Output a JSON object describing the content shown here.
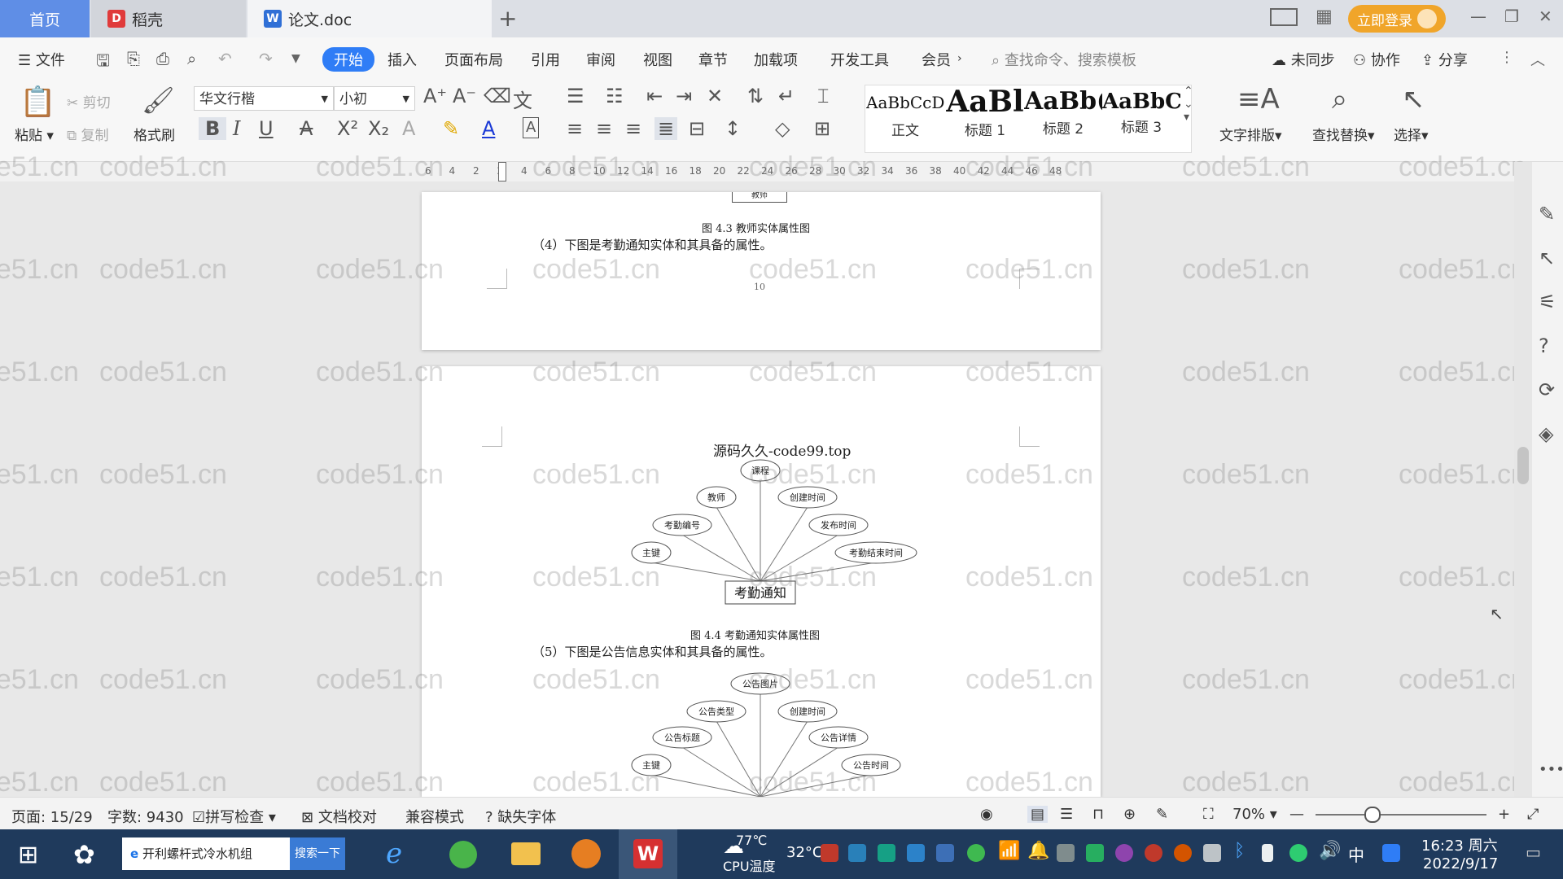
{
  "tabs": [
    {
      "label": "首页"
    },
    {
      "label": "稻壳"
    },
    {
      "label": "论文.doc"
    }
  ],
  "titlebar": {
    "login_label": "立即登录"
  },
  "menu": {
    "file_label": "文件",
    "items": [
      "开始",
      "插入",
      "页面布局",
      "引用",
      "审阅",
      "视图",
      "章节",
      "加载项",
      "开发工具",
      "会员"
    ],
    "search_cmd": "查找命令、搜索模板",
    "sync_label": "未同步",
    "collab_label": "协作",
    "share_label": "分享"
  },
  "toolbar": {
    "paste": "粘贴",
    "cut": "剪切",
    "copy": "复制",
    "format_painter": "格式刷",
    "font_name": "华文行楷",
    "font_size": "小初",
    "styles": [
      {
        "sample": "AaBbCcDd",
        "label": "正文"
      },
      {
        "sample": "AaBl",
        "label": "标题 1"
      },
      {
        "sample": "AaBb(",
        "label": "标题 2"
      },
      {
        "sample": "AaBbC",
        "label": "标题 3"
      }
    ],
    "text_layout": "文字排版",
    "find_replace": "查找替换",
    "select": "选择"
  },
  "ruler": {
    "ticks": [
      "6",
      "4",
      "2",
      "2",
      "4",
      "6",
      "8",
      "10",
      "12",
      "14",
      "16",
      "18",
      "20",
      "22",
      "24",
      "26",
      "28",
      "30",
      "32",
      "34",
      "36",
      "38",
      "40",
      "42",
      "44",
      "46",
      "48"
    ]
  },
  "document": {
    "page1": {
      "top_box": "教师",
      "caption_43": "图 4.3 教师实体属性图",
      "para_4": "（4）下图是考勤通知实体和其具备的属性。",
      "page_number": "10"
    },
    "page2": {
      "header_text": "源码久久-code99.top",
      "diagram1": {
        "entity": "考勤通知",
        "attributes": [
          "主键",
          "考勤编号",
          "教师",
          "课程",
          "创建时间",
          "发布时间",
          "考勤结束时间"
        ]
      },
      "caption_44": "图 4.4 考勤通知实体属性图",
      "para_5": "（5）下图是公告信息实体和其具备的属性。",
      "diagram2": {
        "attributes": [
          "主键",
          "公告标题",
          "公告类型",
          "公告图片",
          "创建时间",
          "公告详情",
          "公告时间"
        ]
      }
    }
  },
  "watermark": "code51.cn",
  "status": {
    "page": "页面: 15/29",
    "words": "字数: 9430",
    "spell": "拼写检查",
    "proof": "文档校对",
    "compat": "兼容模式",
    "missing_font": "缺失字体",
    "zoom": "70%"
  },
  "taskbar": {
    "search_text": "开利螺杆式冷水机组",
    "search_btn": "搜索一下",
    "weather_temp": "77℃",
    "weather_label": "CPU温度",
    "temp2": "32°C",
    "ime": "中",
    "time": "16:23 周六",
    "date": "2022/9/17"
  },
  "colors": {
    "accent": "#2f7df6",
    "home_tab": "#5f8ee6",
    "login": "#f0a52a",
    "taskbar": "#1f3a5c"
  }
}
